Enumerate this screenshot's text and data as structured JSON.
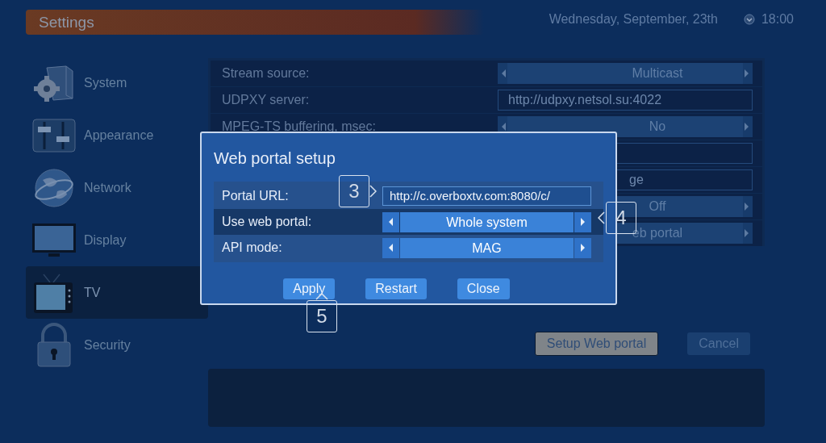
{
  "header": {
    "title": "Settings",
    "date": "Wednesday, September, 23th",
    "time": "18:00"
  },
  "sidebar": {
    "items": [
      {
        "label": "System",
        "kind": "system",
        "selected": false
      },
      {
        "label": "Appearance",
        "kind": "appearance",
        "selected": false
      },
      {
        "label": "Network",
        "kind": "network",
        "selected": false
      },
      {
        "label": "Display",
        "kind": "display",
        "selected": false
      },
      {
        "label": "TV",
        "kind": "tv",
        "selected": true
      },
      {
        "label": "Security",
        "kind": "security",
        "selected": false
      }
    ]
  },
  "settings": {
    "rows": [
      {
        "kind": "selector",
        "label": "Stream source:",
        "value": "Multicast"
      },
      {
        "kind": "field",
        "label": "UDPXY server:",
        "value": "http://udpxy.netsol.su:4022"
      },
      {
        "kind": "selector",
        "label": "MPEG-TS buffering, msec:",
        "value": "No"
      },
      {
        "kind": "field"
      },
      {
        "kind": "field",
        "value": "ge"
      },
      {
        "kind": "selector",
        "value": "Off"
      },
      {
        "kind": "selector",
        "value": "eb portal"
      }
    ]
  },
  "buttons": [
    {
      "label": "Setup Web portal",
      "focused": true
    },
    {
      "label": "Cancel",
      "focused": false
    }
  ],
  "dialog": {
    "title": "Web portal setup",
    "rows": [
      {
        "kind": "field",
        "label": "Portal URL:",
        "value": "http://c.overboxtv.com:8080/c/",
        "selected": false
      },
      {
        "kind": "selector",
        "label": "Use web portal:",
        "value": "Whole system",
        "selected": true
      },
      {
        "kind": "selector",
        "label": "API mode:",
        "value": "MAG",
        "selected": false
      }
    ],
    "buttons": [
      "Apply",
      "Restart",
      "Close"
    ]
  },
  "callouts": [
    {
      "number": "3",
      "kind": "pointer-right"
    },
    {
      "number": "4",
      "kind": "pointer-left"
    },
    {
      "number": "5",
      "kind": "pointer-up"
    }
  ]
}
